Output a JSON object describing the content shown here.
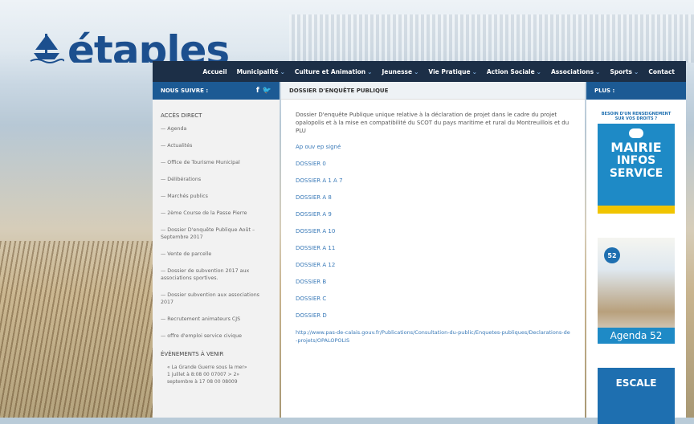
{
  "brand": {
    "name": "étaples"
  },
  "nav": {
    "items": [
      {
        "label": "Accueil",
        "caret": false
      },
      {
        "label": "Municipalité",
        "caret": true
      },
      {
        "label": "Culture et Animation",
        "caret": true
      },
      {
        "label": "Jeunesse",
        "caret": true
      },
      {
        "label": "Vie Pratique",
        "caret": true
      },
      {
        "label": "Action Sociale",
        "caret": true
      },
      {
        "label": "Associations",
        "caret": true
      },
      {
        "label": "Sports",
        "caret": true
      },
      {
        "label": "Contact",
        "caret": false
      }
    ]
  },
  "left": {
    "follow_title": "NOUS SUIVRE :",
    "acces_title": "ACCÈS DIRECT",
    "links": [
      "— Agenda",
      "— Actualités",
      "— Office de Tourisme Municipal",
      "— Délibérations",
      "— Marchés publics",
      "— 2ème Course de la Passe Pierre",
      "— Dossier D'enquête Publique Août – Septembre 2017",
      "— Vente de parcelle",
      "— Dossier de subvention 2017 aux associations sportives.",
      "— Dossier subvention aux associations 2017",
      "— Recrutement animateurs CJS",
      "— offre d'emploi service civique"
    ],
    "events_title": "ÉVÈNEMENTS À VENIR",
    "events": [
      "« La Grande Guerre sous la mer»",
      "1 juillet à 8:08 00 07007 > 2»",
      "septembre à 17 08 00 08009"
    ]
  },
  "main": {
    "title": "DOSSIER D'ENQUÊTE PUBLIQUE",
    "intro": "Dossier D'enquête Publique unique relative à la déclaration de projet dans le cadre du projet opalopolis et à la mise en compatibilité du SCOT du pays maritime et rural du Montreuillois et du PLU",
    "documents": [
      "Ap ouv ep signé",
      "DOSSIER 0",
      "DOSSIER A 1 A 7",
      "DOSSIER A 8",
      "DOSSIER A 9",
      "DOSSIER A 10",
      "DOSSIER A 11",
      "DOSSIER A 12",
      "DOSSIER B",
      "DOSSIER C",
      "DOSSIER D"
    ],
    "url": "http://www.pas-de-calais.gouv.fr/Publications/Consultation-du-public/Enquetes-publiques/Declarations-de-projets/OPALOPOLIS"
  },
  "right": {
    "title": "PLUS :",
    "ad1": {
      "top": "BESOIN D'UN RENSEIGNEMENT SUR VOS DROITS ?",
      "line1": "MAIRIE",
      "line2": "INFOS",
      "line3": "SERVICE"
    },
    "ad2": {
      "badge": "52",
      "label": "Agenda 52"
    },
    "ad3": {
      "title": "ESCALE"
    }
  }
}
